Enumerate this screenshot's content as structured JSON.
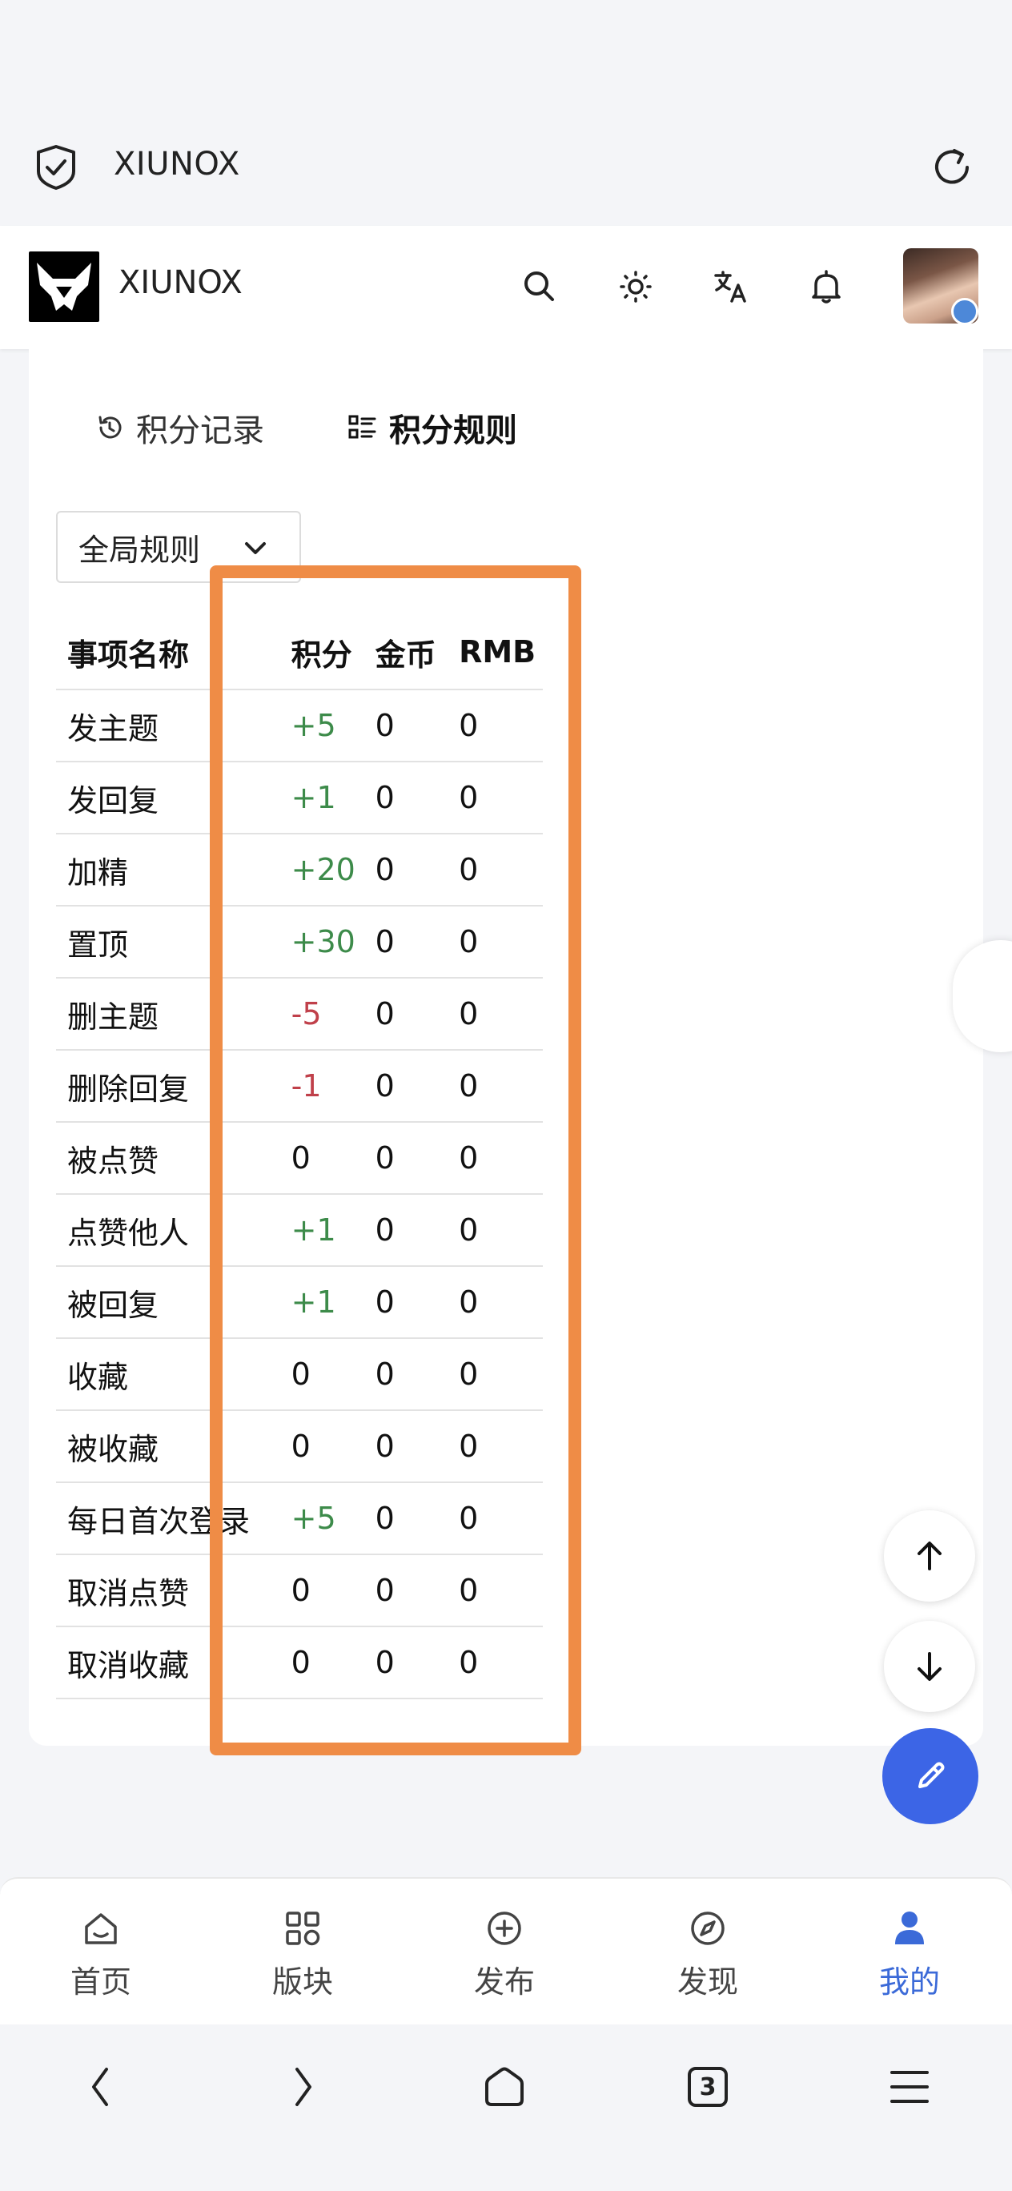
{
  "browser": {
    "url_text": "XIUNOX"
  },
  "header": {
    "site_name": "XIUNOX",
    "icons": [
      "search-icon",
      "theme-sun-icon",
      "translate-icon",
      "bell-icon"
    ]
  },
  "tabs": [
    {
      "label": "积分记录",
      "icon": "history-icon",
      "active": false
    },
    {
      "label": "积分规则",
      "icon": "list-icon",
      "active": true
    }
  ],
  "scope_select": {
    "value": "全局规则"
  },
  "table": {
    "headers": [
      "事项名称",
      "积分",
      "金币",
      "RMB"
    ],
    "rows": [
      {
        "name": "发主题",
        "points": "+5",
        "gold": "0",
        "rmb": "0",
        "sign": "pos"
      },
      {
        "name": "发回复",
        "points": "+1",
        "gold": "0",
        "rmb": "0",
        "sign": "pos"
      },
      {
        "name": "加精",
        "points": "+20",
        "gold": "0",
        "rmb": "0",
        "sign": "pos"
      },
      {
        "name": "置顶",
        "points": "+30",
        "gold": "0",
        "rmb": "0",
        "sign": "pos"
      },
      {
        "name": "删主题",
        "points": "-5",
        "gold": "0",
        "rmb": "0",
        "sign": "neg"
      },
      {
        "name": "删除回复",
        "points": "-1",
        "gold": "0",
        "rmb": "0",
        "sign": "neg"
      },
      {
        "name": "被点赞",
        "points": "0",
        "gold": "0",
        "rmb": "0",
        "sign": "zero"
      },
      {
        "name": "点赞他人",
        "points": "+1",
        "gold": "0",
        "rmb": "0",
        "sign": "pos"
      },
      {
        "name": "被回复",
        "points": "+1",
        "gold": "0",
        "rmb": "0",
        "sign": "pos"
      },
      {
        "name": "收藏",
        "points": "0",
        "gold": "0",
        "rmb": "0",
        "sign": "zero"
      },
      {
        "name": "被收藏",
        "points": "0",
        "gold": "0",
        "rmb": "0",
        "sign": "zero"
      },
      {
        "name": "每日首次登录",
        "points": "+5",
        "gold": "0",
        "rmb": "0",
        "sign": "pos"
      },
      {
        "name": "取消点赞",
        "points": "0",
        "gold": "0",
        "rmb": "0",
        "sign": "zero"
      },
      {
        "name": "取消收藏",
        "points": "0",
        "gold": "0",
        "rmb": "0",
        "sign": "zero"
      }
    ]
  },
  "colors": {
    "positive": "#3d8b4a",
    "negative": "#c0404a",
    "highlight": "#ef8c46",
    "accent": "#3c65e6"
  },
  "bottom_nav": [
    {
      "label": "首页",
      "icon": "home-icon"
    },
    {
      "label": "版块",
      "icon": "grid-icon"
    },
    {
      "label": "发布",
      "icon": "plus-circle-icon"
    },
    {
      "label": "发现",
      "icon": "compass-icon"
    },
    {
      "label": "我的",
      "icon": "user-icon",
      "active": true
    }
  ],
  "system_bar": {
    "tabs_count": "3"
  }
}
